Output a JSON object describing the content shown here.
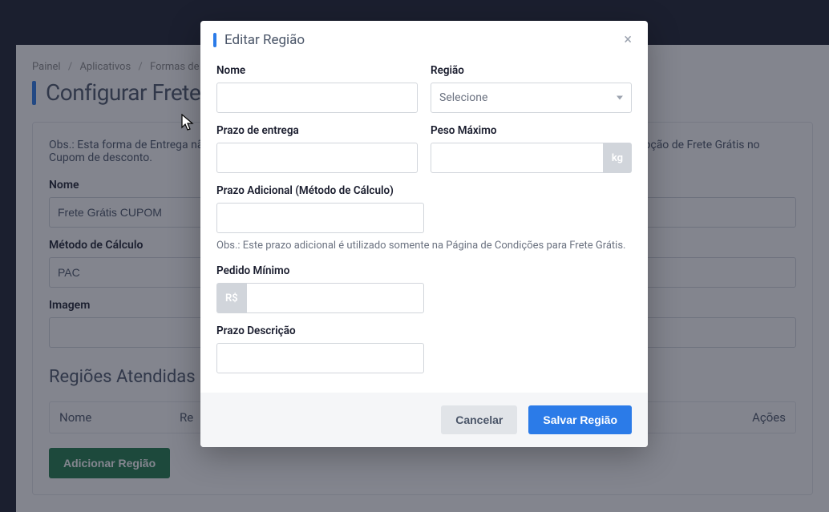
{
  "breadcrumb": {
    "a": "Painel",
    "b": "Aplicativos",
    "c": "Formas de Envio"
  },
  "page": {
    "title": "Configurar Frete",
    "note": "Obs.: Esta forma de Entrega não fica disponível para o Cliente no Carrinho ou Checkout, ela é destinada apenas para a opção de Frete Grátis no Cupom de desconto."
  },
  "bgform": {
    "nome_label": "Nome",
    "nome_value": "Frete Grátis CUPOM",
    "metodo_label": "Método de Cálculo",
    "metodo_value": "PAC",
    "imagem_label": "Imagem",
    "section_title": "Regiões Atendidas",
    "th_nome": "Nome",
    "th_re": "Re",
    "th_acoes": "Ações",
    "add_btn": "Adicionar Região"
  },
  "modal": {
    "title": "Editar Região",
    "nome_label": "Nome",
    "regiao_label": "Região",
    "regiao_placeholder": "Selecione",
    "prazo_label": "Prazo de entrega",
    "peso_label": "Peso Máximo",
    "peso_unit": "kg",
    "prazo_adicional_label": "Prazo Adicional (Método de Cálculo)",
    "prazo_adicional_note": "Obs.: Este prazo adicional é utilizado somente na Página de Condições para Frete Grátis.",
    "pedido_min_label": "Pedido Mínimo",
    "pedido_min_prefix": "R$",
    "prazo_desc_label": "Prazo Descrição",
    "cancel": "Cancelar",
    "save": "Salvar Região"
  }
}
